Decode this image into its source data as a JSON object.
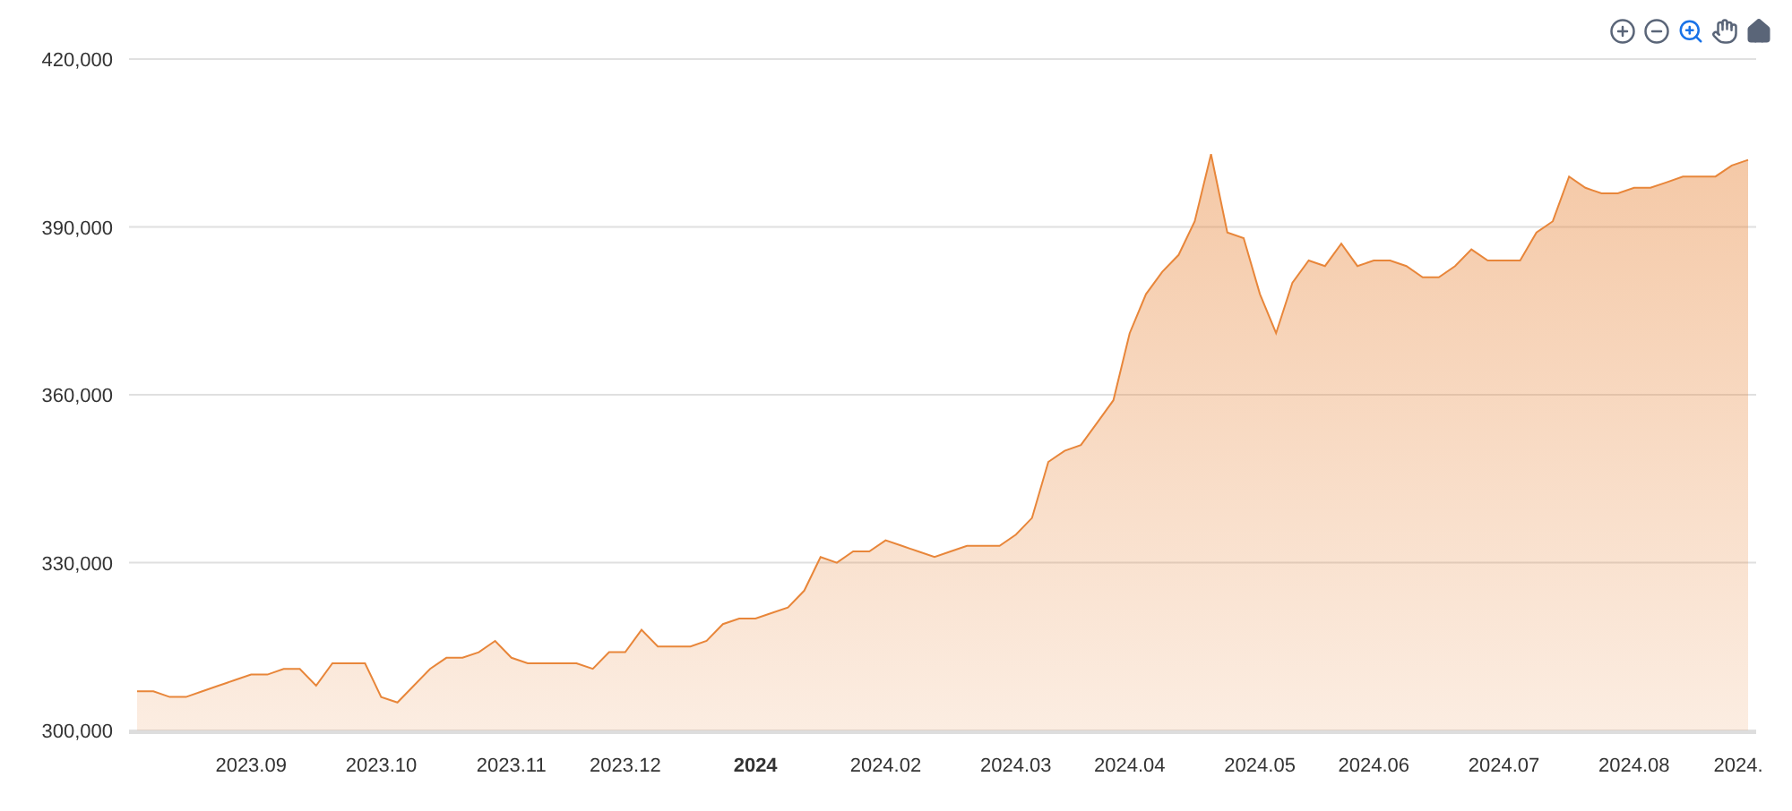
{
  "toolbar": [
    {
      "kind": "zoom_in",
      "selected": false
    },
    {
      "kind": "zoom_out",
      "selected": false
    },
    {
      "kind": "zoom",
      "selected": true
    },
    {
      "kind": "pan",
      "selected": false
    },
    {
      "kind": "reset",
      "selected": false
    }
  ],
  "chart_data": {
    "type": "area",
    "grid": true,
    "ylim": [
      300000,
      420000
    ],
    "yticks": [
      {
        "value": 300000,
        "label": "300,000"
      },
      {
        "value": 330000,
        "label": "330,000"
      },
      {
        "value": 360000,
        "label": "360,000"
      },
      {
        "value": 390000,
        "label": "390,000"
      },
      {
        "value": 420000,
        "label": "420,000"
      }
    ],
    "categories": [
      null,
      null,
      null,
      null,
      null,
      null,
      null,
      "2023.09",
      null,
      null,
      null,
      null,
      null,
      null,
      null,
      "2023.10",
      null,
      null,
      null,
      null,
      null,
      null,
      null,
      "2023.11",
      null,
      null,
      null,
      null,
      null,
      null,
      "2023.12",
      null,
      null,
      null,
      null,
      null,
      null,
      null,
      "2024",
      null,
      null,
      null,
      null,
      null,
      null,
      null,
      "2024.02",
      null,
      null,
      null,
      null,
      null,
      null,
      null,
      "2024.03",
      null,
      null,
      null,
      null,
      null,
      null,
      "2024.04",
      null,
      null,
      null,
      null,
      null,
      null,
      null,
      "2024.05",
      null,
      null,
      null,
      null,
      null,
      null,
      "2024.06",
      null,
      null,
      null,
      null,
      null,
      null,
      null,
      "2024.07",
      null,
      null,
      null,
      null,
      null,
      null,
      null,
      "2024.08",
      null,
      null,
      null,
      null,
      null,
      null,
      "2024."
    ],
    "series": [
      {
        "color": "#e8863a",
        "values": [
          307000,
          307000,
          306000,
          306000,
          307000,
          308000,
          309000,
          310000,
          310000,
          311000,
          311000,
          308000,
          312000,
          312000,
          312000,
          306000,
          305000,
          308000,
          311000,
          313000,
          313000,
          314000,
          316000,
          313000,
          312000,
          312000,
          312000,
          312000,
          311000,
          314000,
          314000,
          318000,
          315000,
          315000,
          315000,
          316000,
          319000,
          320000,
          320000,
          321000,
          322000,
          325000,
          331000,
          330000,
          332000,
          332000,
          334000,
          333000,
          332000,
          331000,
          332000,
          333000,
          333000,
          333000,
          335000,
          338000,
          348000,
          350000,
          351000,
          355000,
          359000,
          371000,
          378000,
          382000,
          385000,
          391000,
          403000,
          389000,
          388000,
          378000,
          371000,
          380000,
          384000,
          383000,
          387000,
          383000,
          384000,
          384000,
          383000,
          381000,
          381000,
          383000,
          386000,
          384000,
          384000,
          384000,
          389000,
          391000,
          399000,
          397000,
          396000,
          396000,
          397000,
          397000,
          398000,
          399000,
          399000,
          399000,
          401000,
          402000
        ]
      }
    ]
  }
}
